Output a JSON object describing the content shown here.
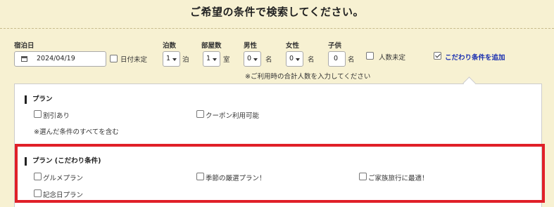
{
  "page": {
    "title": "ご希望の条件で検索してください。"
  },
  "search": {
    "checkin_label": "宿泊日",
    "checkin_value": "2024/04/19",
    "date_undecided_label": "日付未定",
    "nights_label": "泊数",
    "nights_value": "1",
    "nights_unit": "泊",
    "rooms_label": "部屋数",
    "rooms_value": "1",
    "rooms_unit": "室",
    "male_label": "男性",
    "male_value": "0",
    "male_unit": "名",
    "female_label": "女性",
    "female_value": "0",
    "female_unit": "名",
    "child_label": "子供",
    "child_value": "0",
    "child_unit": "名",
    "people_undecided_label": "人数未定",
    "add_conditions_label": "こだわり条件を追加",
    "note": "※ご利用時の合計人数を入力してください"
  },
  "plan": {
    "heading": "プラン",
    "options": [
      "割引あり",
      "クーポン利用可能"
    ],
    "note": "※選んだ条件のすべてを含む"
  },
  "plan_special": {
    "heading": "プラン (こだわり条件)",
    "options": [
      "グルメプラン",
      "季節の厳選プラン！",
      "ご家族旅行に最適！",
      "記念日プラン"
    ]
  },
  "colors": {
    "background": "#f7f1d2",
    "highlight": "#e02028",
    "link": "#1a2fb0"
  }
}
